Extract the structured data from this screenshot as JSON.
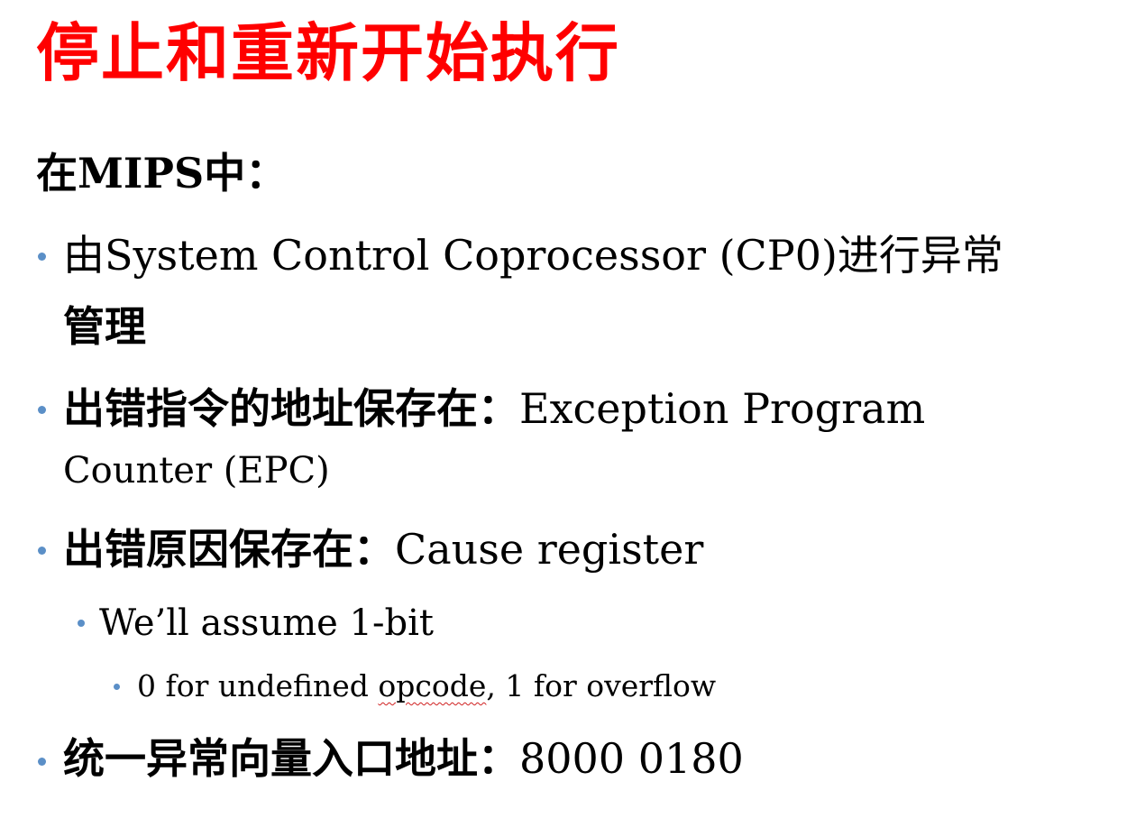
{
  "slide": {
    "title": "停止和重新开始执行",
    "intro": "在MIPS中：",
    "colors": {
      "title": "#ff0000",
      "text": "#000000",
      "bullet": "#5b8fc7",
      "spellcheck_underline": "#d02020"
    },
    "bullets": [
      {
        "line1": "由System Control Coprocessor (CP0)进行异常",
        "line2": "管理"
      },
      {
        "line1_cjk": "出错指令的地址保存在：",
        "line1_en": "Exception Program",
        "line2": "Counter (EPC)"
      },
      {
        "line1_cjk": "出错原因保存在：",
        "line1_en": "Cause register",
        "sub": {
          "text": "We’ll assume 1-bit",
          "subsub": {
            "text_before": "0 for undefined ",
            "text_underlined": "opcode",
            "text_after": ", 1 for overflow"
          }
        }
      },
      {
        "line1_cjk": "统一异常向量入口地址：",
        "line1_en": "8000 0180"
      }
    ]
  }
}
